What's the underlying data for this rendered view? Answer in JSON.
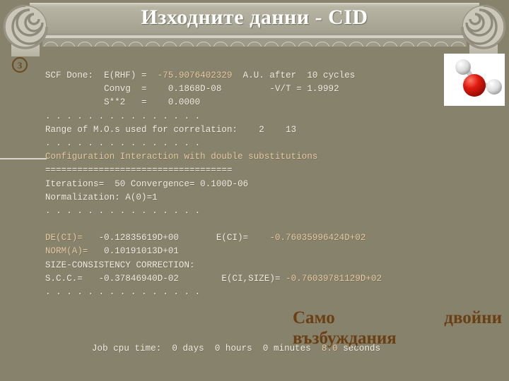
{
  "slide": {
    "title": "Изходните данни - CID",
    "bullet_marker": "3",
    "colors": {
      "background": "#87826b",
      "banner": "#a9a594",
      "console_text": "#f2efe6",
      "highlight": "#e9cba4",
      "annotation": "#6b3f14"
    }
  },
  "molecule": {
    "name": "water-molecule-model",
    "atoms": [
      {
        "element": "O",
        "color": "#cc1111"
      },
      {
        "element": "H",
        "color": "#e8e8e8"
      },
      {
        "element": "H",
        "color": "#e8e8e8"
      }
    ]
  },
  "console": {
    "lines": [
      [
        {
          "t": "SCF Done:  E(RHF) =  ",
          "hl": false
        },
        {
          "t": "-75.9076402329",
          "hl": true
        },
        {
          "t": "  A.U. after  10 cycles",
          "hl": false
        }
      ],
      [
        {
          "t": "           Convg  =    0.1868D-08         -V/T = 1.9992",
          "hl": false
        }
      ],
      [
        {
          "t": "           S**2   =    0.0000",
          "hl": false
        }
      ],
      [
        {
          "t": ". . . . . . . . . . . . . . .",
          "hl": false
        }
      ],
      [
        {
          "t": "Range of M.O.s used for correlation:    2    13",
          "hl": false
        }
      ],
      [
        {
          "t": ". . . . . . . . . . . . . . .",
          "hl": false
        }
      ],
      [
        {
          "t": "Configuration Interaction with double substitutions",
          "hl": true
        }
      ],
      [
        {
          "t": "===================================",
          "hl": false
        }
      ],
      [
        {
          "t": "Iterations=  50 Convergence= 0.100D-06",
          "hl": false
        }
      ],
      [
        {
          "t": "Normalization: A(0)=1",
          "hl": false
        }
      ],
      [
        {
          "t": ". . . . . . . . . . . . . . .",
          "hl": false
        }
      ],
      [
        {
          "t": "",
          "hl": false
        }
      ],
      [
        {
          "t": "DE(CI)= ",
          "hl": true
        },
        {
          "t": "  -0.12835619D+00       E(CI)=    ",
          "hl": false
        },
        {
          "t": "-0.76035996424D+02",
          "hl": true
        }
      ],
      [
        {
          "t": "NORM(A)=",
          "hl": true
        },
        {
          "t": "   0.10191013D+01",
          "hl": false
        }
      ],
      [
        {
          "t": "SIZE-CONSISTENCY CORRECTION:",
          "hl": false
        }
      ],
      [
        {
          "t": "S.C.C.=   -0.37846940D-02        E(CI,SIZE)= ",
          "hl": false
        },
        {
          "t": "-0.76039781129D+02",
          "hl": true
        }
      ],
      [
        {
          "t": ". . . . . . . . . . . . . . .",
          "hl": false
        }
      ]
    ]
  },
  "job_line": [
    {
      "t": "Job cpu time:  0 days  0 hours  0 minutes  ",
      "hl": false
    },
    {
      "t": "8.0",
      "hl": true
    },
    {
      "t": " seconds",
      "hl": false
    }
  ],
  "annotation": {
    "word1": "Само",
    "word2": "двойни",
    "word3": "възбуждания"
  }
}
